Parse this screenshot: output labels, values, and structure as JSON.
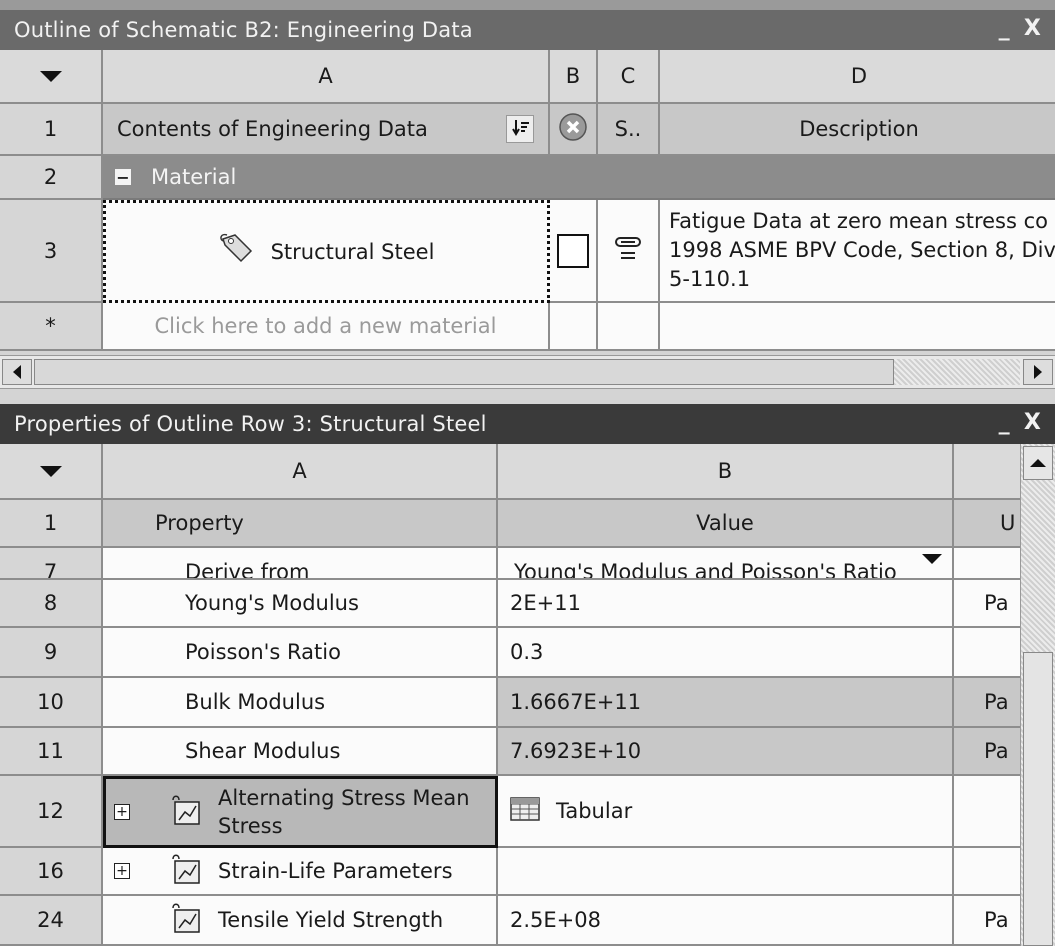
{
  "outline": {
    "title": "Outline of Schematic B2: Engineering Data",
    "minimize": "_",
    "close": "X",
    "columns": [
      "A",
      "B",
      "C",
      "D"
    ],
    "row1": {
      "num": "1",
      "contents": "Contents of Engineering Data",
      "c": "S..",
      "d": "Description"
    },
    "row2": {
      "num": "2",
      "label": "Material",
      "toggle": "−"
    },
    "row3": {
      "num": "3",
      "name": "Structural Steel",
      "desc_line1": "Fatigue Data at zero mean stress co",
      "desc_line2": "1998 ASME BPV Code, Section 8, Div",
      "desc_line3": "5-110.1"
    },
    "row_new": {
      "num": "*",
      "placeholder": "Click here to add a new material"
    }
  },
  "properties": {
    "title": "Properties of Outline Row 3: Structural Steel",
    "minimize": "_",
    "close": "X",
    "columns": [
      "A",
      "B"
    ],
    "col_c_partial": "U",
    "header": {
      "num": "1",
      "property": "Property",
      "value": "Value"
    },
    "rows": [
      {
        "num": "7",
        "property": "Derive from",
        "value": "Young's Modulus and Poisson's Ratio",
        "unit": ""
      },
      {
        "num": "8",
        "property": "Young's Modulus",
        "value": "2E+11",
        "unit": "Pa"
      },
      {
        "num": "9",
        "property": "Poisson's Ratio",
        "value": "0.3",
        "unit": ""
      },
      {
        "num": "10",
        "property": "Bulk Modulus",
        "value": "1.6667E+11",
        "unit": "Pa"
      },
      {
        "num": "11",
        "property": "Shear Modulus",
        "value": "7.6923E+10",
        "unit": "Pa"
      },
      {
        "num": "12",
        "property_line1": "Alternating Stress Mean",
        "property_line2": "Stress",
        "value": "Tabular",
        "unit": "",
        "toggle": "+"
      },
      {
        "num": "16",
        "property": "Strain-Life Parameters",
        "value": "",
        "unit": "",
        "toggle": "+"
      },
      {
        "num": "24",
        "property": "Tensile Yield Strength",
        "value": "2.5E+08",
        "unit": "Pa"
      }
    ]
  }
}
